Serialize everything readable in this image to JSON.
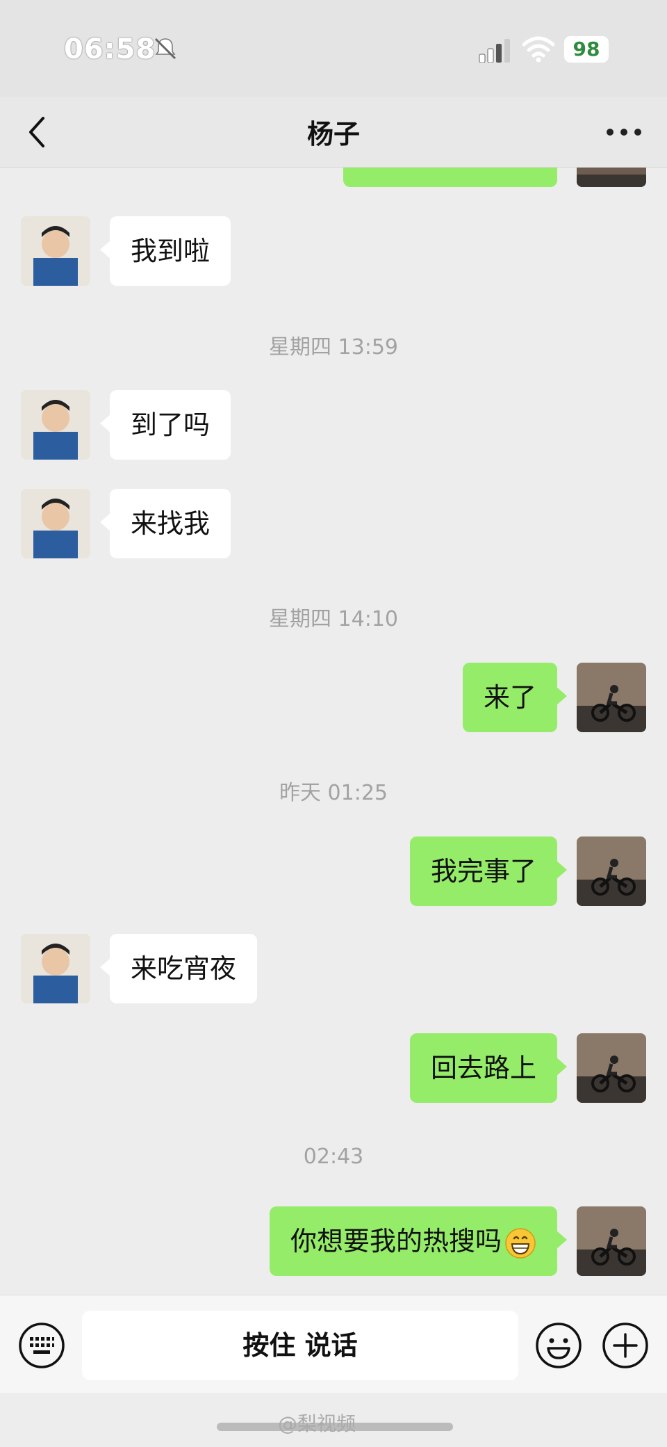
{
  "status_bar": {
    "time": "06:58",
    "battery": "98"
  },
  "header": {
    "title": "杨子"
  },
  "messages": [
    {
      "side": "in",
      "text": "我到啦"
    },
    {
      "stamp": "星期四 13:59"
    },
    {
      "side": "in",
      "text": "到了吗"
    },
    {
      "side": "in",
      "text": "来找我"
    },
    {
      "stamp": "星期四 14:10"
    },
    {
      "side": "out",
      "text": "来了"
    },
    {
      "stamp": "昨天 01:25"
    },
    {
      "side": "out",
      "text": "我完事了"
    },
    {
      "side": "in",
      "text": "来吃宵夜"
    },
    {
      "side": "out",
      "text": "回去路上"
    },
    {
      "stamp": "02:43"
    },
    {
      "side": "out",
      "text": "你想要我的热搜吗",
      "emoji": "grinning-face"
    }
  ],
  "input_bar": {
    "hold_to_talk": "按住 说话"
  },
  "watermark": "@梨视频",
  "colors": {
    "outgoing_bubble": "#95ec69",
    "incoming_bubble": "#ffffff",
    "background": "#ededed"
  }
}
